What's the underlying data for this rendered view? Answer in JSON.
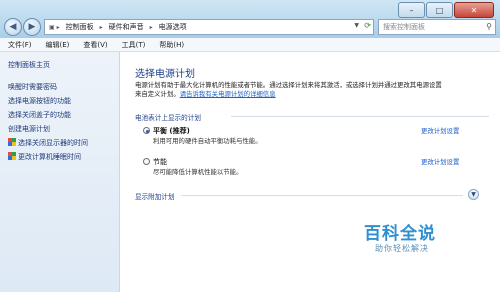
{
  "address": {
    "segments": [
      "控制面板",
      "硬件和声音",
      "电源选项"
    ],
    "search_placeholder": "搜索控制面板"
  },
  "window_controls": {
    "minimize": "–",
    "maximize": "□",
    "close": "✕"
  },
  "menu": [
    "文件(F)",
    "编辑(E)",
    "查看(V)",
    "工具(T)",
    "帮助(H)"
  ],
  "sidebar": {
    "home": "控制面板主页",
    "items": [
      {
        "label": "唤醒时需要密码",
        "icon": ""
      },
      {
        "label": "选择电源按钮的功能",
        "icon": ""
      },
      {
        "label": "选择关闭盖子的功能",
        "icon": ""
      },
      {
        "label": "创建电源计划",
        "icon": ""
      },
      {
        "label": "选择关闭显示器的时间",
        "icon": "shield-icon"
      },
      {
        "label": "更改计算机睡眠时间",
        "icon": "shield-icon"
      }
    ]
  },
  "main": {
    "title": "选择电源计划",
    "desc_line1": "电源计划有助于最大化计算机的性能或者节能。通过选择计划来将其激活，或选择计划并通过更改其电源设置",
    "desc_line2_prefix": "来自定义计划。",
    "desc_link": "请告诉我有关电源计划的详细信息",
    "group_header": "电池表计上显示的计划",
    "plans": [
      {
        "name": "平衡 (推荐)",
        "desc": "利用可用的硬件自动平衡功耗与性能。",
        "link": "更改计划设置",
        "selected": true
      },
      {
        "name": "节能",
        "desc": "尽可能降低计算机性能以节能。",
        "link": "更改计划设置",
        "selected": false
      }
    ],
    "extra_header": "显示附加计划"
  },
  "watermark": {
    "title": "百科全说",
    "subtitle": "助你轻松解决"
  }
}
